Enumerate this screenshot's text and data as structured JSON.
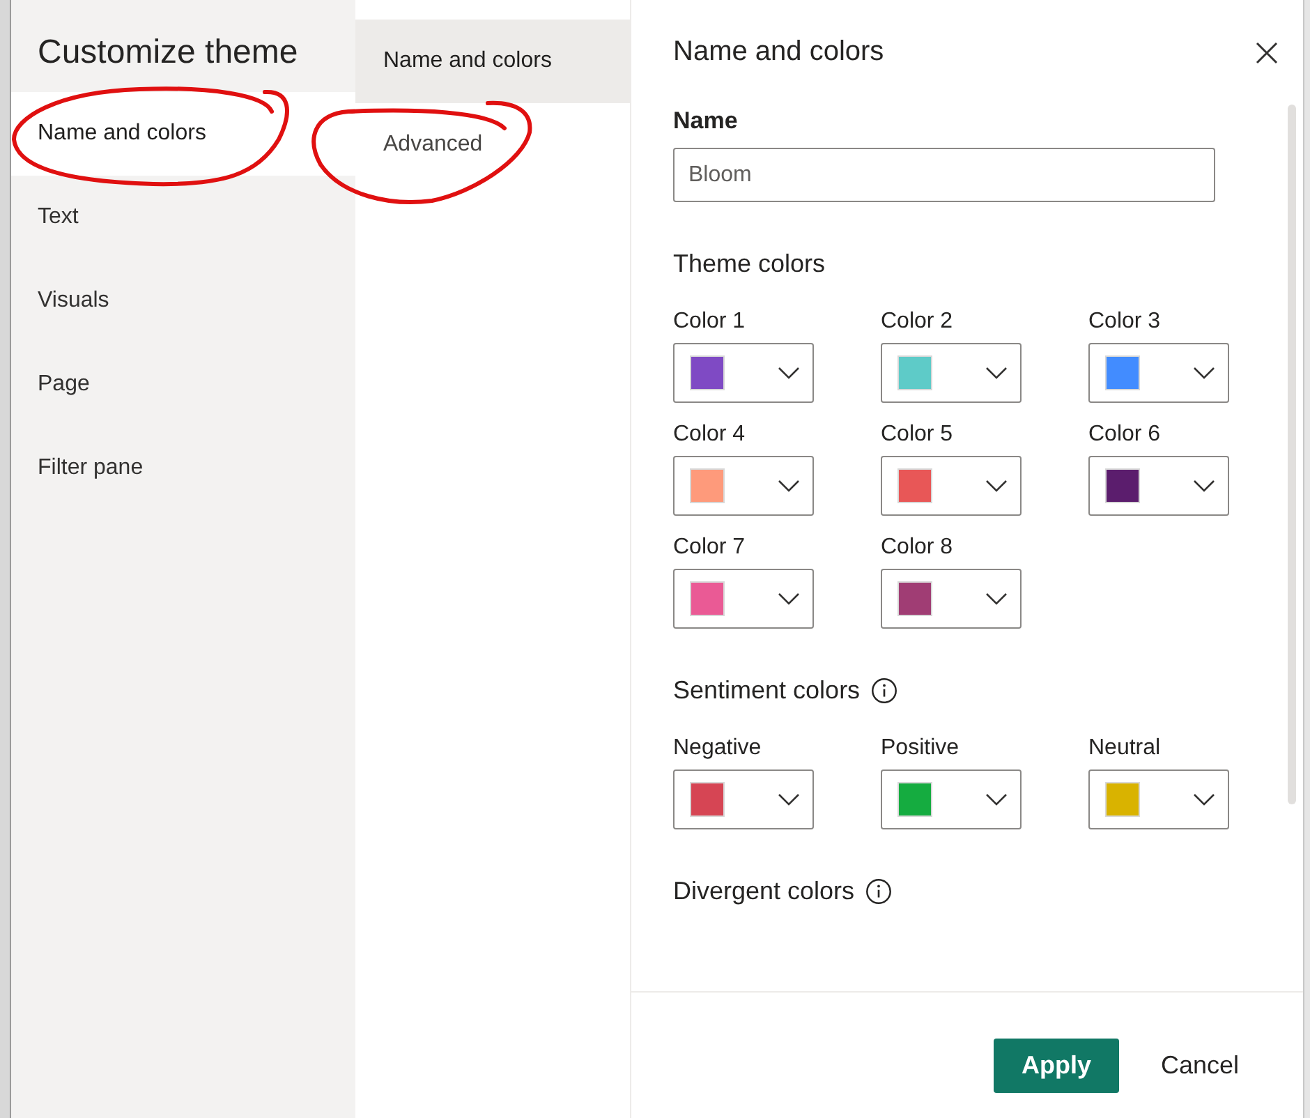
{
  "nav": {
    "title": "Customize theme",
    "items": [
      {
        "label": "Name and colors",
        "selected": true
      },
      {
        "label": "Text",
        "selected": false
      },
      {
        "label": "Visuals",
        "selected": false
      },
      {
        "label": "Page",
        "selected": false
      },
      {
        "label": "Filter pane",
        "selected": false
      }
    ]
  },
  "subnav": {
    "items": [
      {
        "label": "Name and colors",
        "selected": true
      },
      {
        "label": "Advanced",
        "selected": false
      }
    ]
  },
  "panel": {
    "title": "Name and colors",
    "name_field": {
      "label": "Name",
      "value": "Bloom"
    },
    "sections": [
      {
        "title": "Theme colors",
        "info": false,
        "pickers": [
          {
            "label": "Color 1",
            "color": "#7f4ac4"
          },
          {
            "label": "Color 2",
            "color": "#5ecbc8"
          },
          {
            "label": "Color 3",
            "color": "#428cff"
          },
          {
            "label": "Color 4",
            "color": "#fe9a7b"
          },
          {
            "label": "Color 5",
            "color": "#e85757"
          },
          {
            "label": "Color 6",
            "color": "#5b1d6d"
          },
          {
            "label": "Color 7",
            "color": "#ea5a95"
          },
          {
            "label": "Color 8",
            "color": "#a03d74"
          }
        ]
      },
      {
        "title": "Sentiment colors",
        "info": true,
        "pickers": [
          {
            "label": "Negative",
            "color": "#d64554"
          },
          {
            "label": "Positive",
            "color": "#15ac40"
          },
          {
            "label": "Neutral",
            "color": "#d9b300"
          }
        ]
      },
      {
        "title": "Divergent colors",
        "info": true
      }
    ]
  },
  "buttons": [
    {
      "label": "Apply",
      "kind": "primary"
    },
    {
      "label": "Cancel",
      "kind": "secondary"
    }
  ]
}
